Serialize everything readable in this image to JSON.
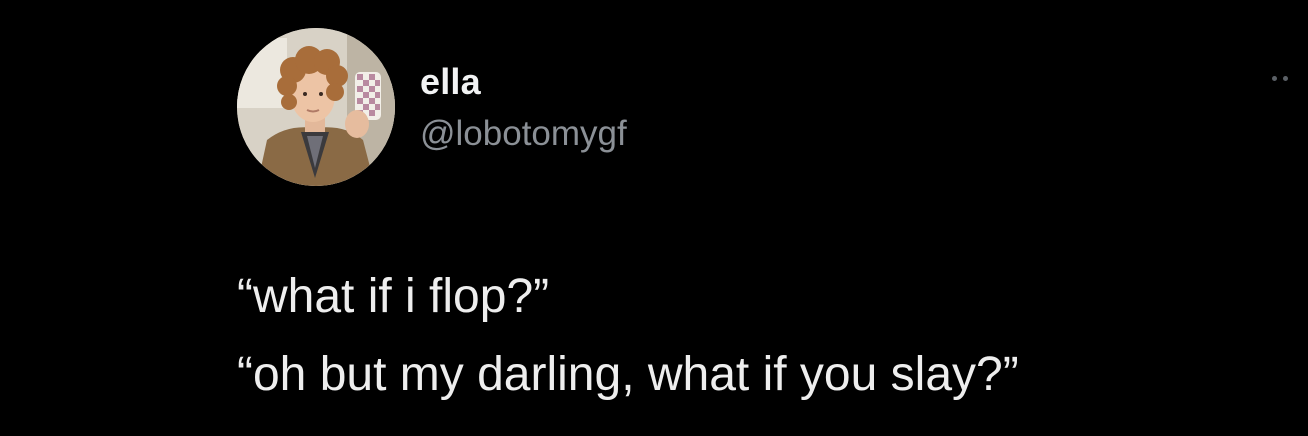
{
  "author": {
    "display_name": "ella",
    "handle": "@lobotomygf",
    "avatar_icon": "profile-photo"
  },
  "menu": {
    "more_icon": "more-horizontal-icon"
  },
  "tweet": {
    "lines": [
      "“what if i flop?”",
      "“oh but my darling, what if you slay?”"
    ]
  },
  "colors": {
    "background": "#000000",
    "text_primary": "#e7e9ea",
    "text_secondary": "#8b9096"
  }
}
